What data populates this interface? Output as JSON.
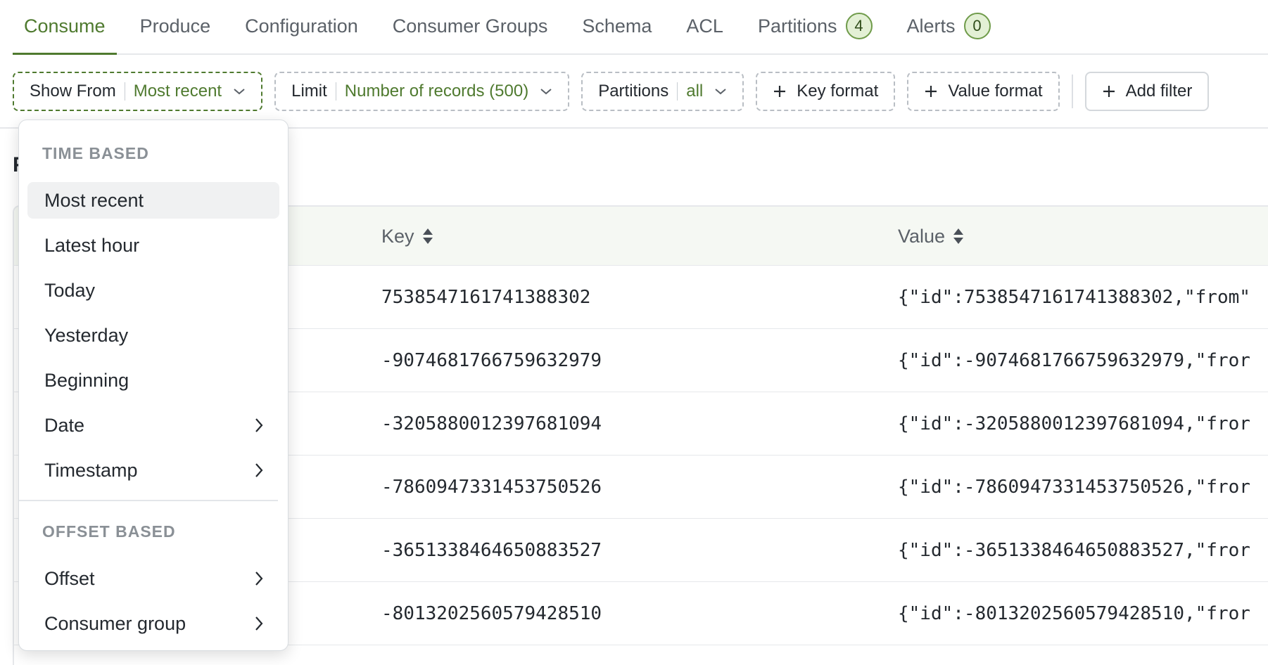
{
  "tabs": [
    {
      "label": "Consume",
      "active": true
    },
    {
      "label": "Produce"
    },
    {
      "label": "Configuration"
    },
    {
      "label": "Consumer Groups"
    },
    {
      "label": "Schema"
    },
    {
      "label": "ACL"
    },
    {
      "label": "Partitions",
      "count": "4"
    },
    {
      "label": "Alerts",
      "count": "0"
    }
  ],
  "filters": {
    "show_from": {
      "label": "Show From",
      "value": "Most recent"
    },
    "limit": {
      "label": "Limit",
      "value": "Number of records (500)"
    },
    "partitions": {
      "label": "Partitions",
      "value": "all"
    },
    "key_format": "Key format",
    "value_format": "Value format",
    "add_filter": "Add filter"
  },
  "section_stub": "F",
  "table": {
    "columns": [
      "Key",
      "Value"
    ],
    "rows": [
      {
        "key": "7538547161741388302",
        "value": "{\"id\":7538547161741388302,\"from\""
      },
      {
        "key": "-9074681766759632979",
        "value": "{\"id\":-9074681766759632979,\"fror"
      },
      {
        "key": "-3205880012397681094",
        "value": "{\"id\":-3205880012397681094,\"fror"
      },
      {
        "key": "-7860947331453750526",
        "value": "{\"id\":-7860947331453750526,\"fror"
      },
      {
        "key": "-3651338464650883527",
        "value": "{\"id\":-3651338464650883527,\"fror"
      },
      {
        "key": "-8013202560579428510",
        "value": "{\"id\":-8013202560579428510,\"fror"
      }
    ]
  },
  "dropdown": {
    "time_based_title": "TIME BASED",
    "time_items": [
      "Most recent",
      "Latest hour",
      "Today",
      "Yesterday",
      "Beginning",
      "Date",
      "Timestamp"
    ],
    "offset_based_title": "OFFSET BASED",
    "offset_items": [
      "Offset",
      "Consumer group"
    ],
    "selected": "Most recent"
  },
  "colors": {
    "accent": "#4f7a2f",
    "badge_bg": "#e3f0d5",
    "header_bg": "#f5f8f3"
  },
  "icons": {
    "chevron": "chevron-down-icon",
    "plus": "plus-icon",
    "sort": "sort-icon",
    "submenu": "chevron-right-icon"
  }
}
